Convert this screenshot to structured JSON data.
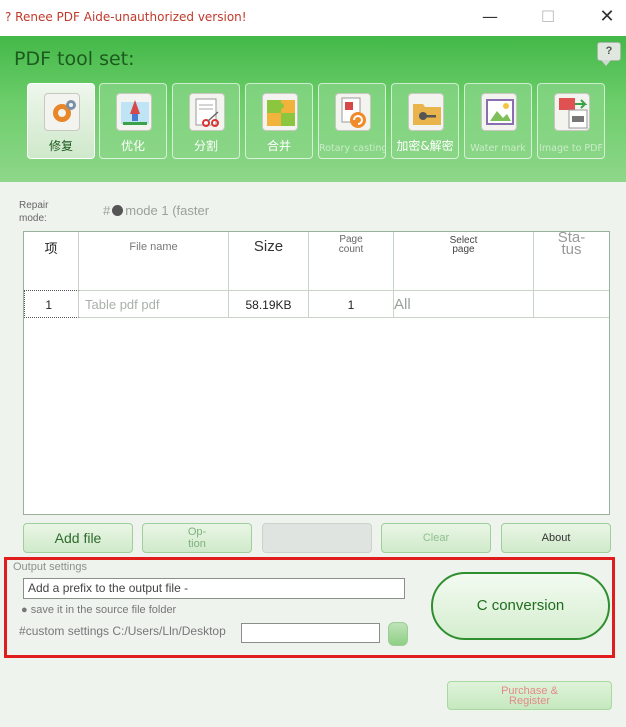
{
  "window": {
    "title": "? Renee PDF Aide-unauthorized version!",
    "minimize": "—",
    "maximize": "☐",
    "close": "✕"
  },
  "header": {
    "title": "PDF tool set:",
    "help": "?"
  },
  "tools": [
    {
      "label": "修复",
      "icon": "repair-gear-icon",
      "active": true
    },
    {
      "label": "优化",
      "icon": "optimize-rocket-icon",
      "active": false
    },
    {
      "label": "分割",
      "icon": "split-scissors-icon",
      "active": false
    },
    {
      "label": "合并",
      "icon": "merge-puzzle-icon",
      "active": false
    },
    {
      "label": "Rotary casting",
      "icon": "rotate-icon",
      "active": false
    },
    {
      "label": "加密&解密",
      "icon": "encrypt-key-icon",
      "active": false
    },
    {
      "label": "Water mark",
      "icon": "watermark-picture-icon",
      "active": false
    },
    {
      "label": "Image to PDF",
      "icon": "image-to-pdf-icon",
      "active": false
    }
  ],
  "repair": {
    "label_line1": "Repair",
    "label_line2": "mode:",
    "prefix": "#",
    "mode_text": "mode 1 (faster"
  },
  "table": {
    "headers": {
      "index": "项",
      "file_name": "File name",
      "size": "Size",
      "page_count_1": "Page",
      "page_count_2": "count",
      "select_page_1": "Select",
      "select_page_2": "page",
      "status_1": "Sta-",
      "status_2": "tus"
    },
    "rows": [
      {
        "index": "1",
        "file_name": "Table pdf pdf",
        "size": "58.19KB",
        "page_count": "1",
        "select_page": "All",
        "status": ""
      }
    ]
  },
  "buttons": {
    "add_file": "Add file",
    "option_1": "Op-",
    "option_2": "tion",
    "remove": "",
    "clear": "Clear",
    "about": "About"
  },
  "output": {
    "legend": "Output settings",
    "prefix_text": "Add a prefix to the output file",
    "prefix_suffix": "-",
    "source_folder": "save it in the source file folder",
    "custom_prefix": "#",
    "custom_settings": "custom settings C:/Users/Lln/Desktop",
    "convert": "C conversion"
  },
  "purchase": {
    "line1": "Purchase &",
    "line2": "Register"
  },
  "colors": {
    "accent_green": "#43b848",
    "highlight_red": "#e11c1c",
    "title_red": "#c0392b"
  }
}
